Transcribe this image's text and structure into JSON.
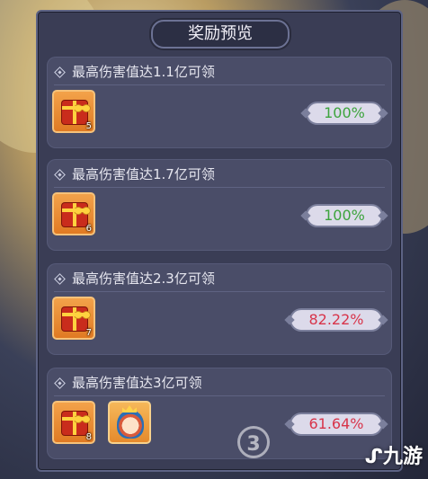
{
  "panel": {
    "title": "奖励预览"
  },
  "tiers": [
    {
      "label": "最高伤害值达1.1亿可领",
      "items": [
        {
          "icon": "gift-box-icon",
          "count": "5"
        }
      ],
      "progress_text": "100%",
      "progress_color": "#3da43d"
    },
    {
      "label": "最高伤害值达1.7亿可领",
      "items": [
        {
          "icon": "gift-box-icon",
          "count": "6"
        }
      ],
      "progress_text": "100%",
      "progress_color": "#3da43d"
    },
    {
      "label": "最高伤害值达2.3亿可领",
      "items": [
        {
          "icon": "gift-box-icon",
          "count": "7"
        }
      ],
      "progress_text": "82.22%",
      "progress_color": "#d8344a"
    },
    {
      "label": "最高伤害值达3亿可领",
      "items": [
        {
          "icon": "gift-box-icon",
          "count": "8"
        },
        {
          "icon": "hero-portrait-icon",
          "count": ""
        }
      ],
      "progress_text": "61.64%",
      "progress_color": "#d8344a"
    }
  ],
  "watermark": {
    "badge": "3",
    "logo_text": "九游"
  }
}
